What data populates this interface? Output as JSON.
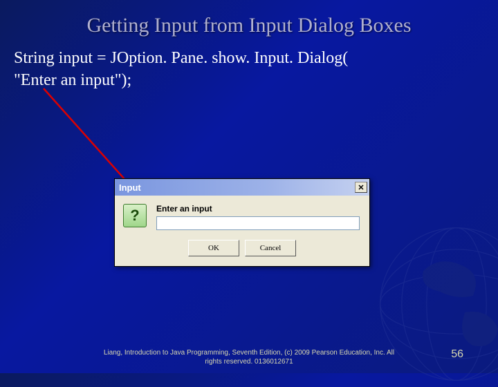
{
  "slide": {
    "title": "Getting Input from Input Dialog Boxes",
    "code_line1": "String input =  JOption. Pane. show. Input. Dialog(",
    "code_line2": "  \"Enter an input\");"
  },
  "dialog": {
    "title": "Input",
    "close_symbol": "✕",
    "question_mark": "?",
    "prompt": "Enter an input",
    "input_value": "",
    "ok_label": "OK",
    "cancel_label": "Cancel"
  },
  "footer": {
    "line1": "Liang, Introduction to Java Programming, Seventh Edition, (c) 2009 Pearson Education, Inc. All",
    "line2": "rights reserved. 0136012671"
  },
  "page_number": "56"
}
